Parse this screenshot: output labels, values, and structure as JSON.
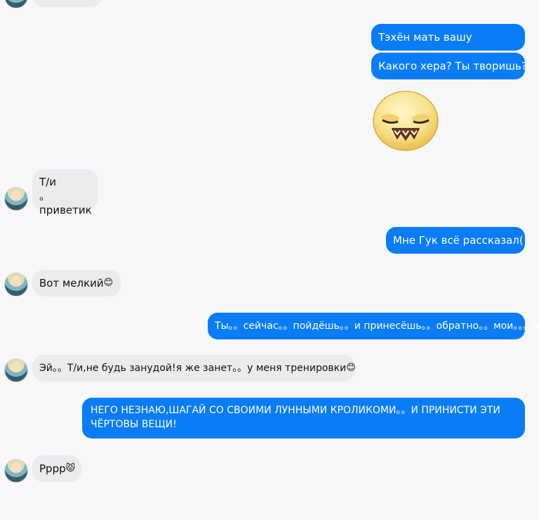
{
  "conversation": {
    "messages": [
      {
        "side": "out",
        "text": "Тэхён мать вашу"
      },
      {
        "side": "out",
        "text": "Какого хера? Ты творишь?"
      },
      {
        "side": "out",
        "type": "sticker",
        "sticker": "grumpy-face-sticker"
      },
      {
        "side": "in",
        "lines": [
          "Т/и",
          "。приветик"
        ]
      },
      {
        "side": "out",
        "text": "Мне Гук всё рассказал("
      },
      {
        "side": "in",
        "text": "Вот мелкий",
        "emoji": "😊"
      },
      {
        "side": "out",
        "text": "Ты。。сейчас。。пойдёшь。。и принесёшь。。обратно。。мои。。。вещи"
      },
      {
        "side": "in",
        "text": "Эй。。Т/и,не будь занудой!я же занет。。у меня тренировки",
        "emoji": "😊"
      },
      {
        "side": "out",
        "lines": [
          "НЕГО НЕЗНАЮ,ШАГАЙ СО СВОИМИ ЛУННЫМИ КРОЛИКОМИ。。И ПРИНИСТИ ЭТИ",
          "ЧЁРТОВЫ ВЕЩИ!"
        ]
      },
      {
        "side": "in",
        "text": "Рррр",
        "emoji": "😾"
      }
    ]
  },
  "colors": {
    "outgoing_bubble": "#0a7cf6",
    "incoming_bubble": "#ebebee",
    "background": "#f7f7f9"
  }
}
